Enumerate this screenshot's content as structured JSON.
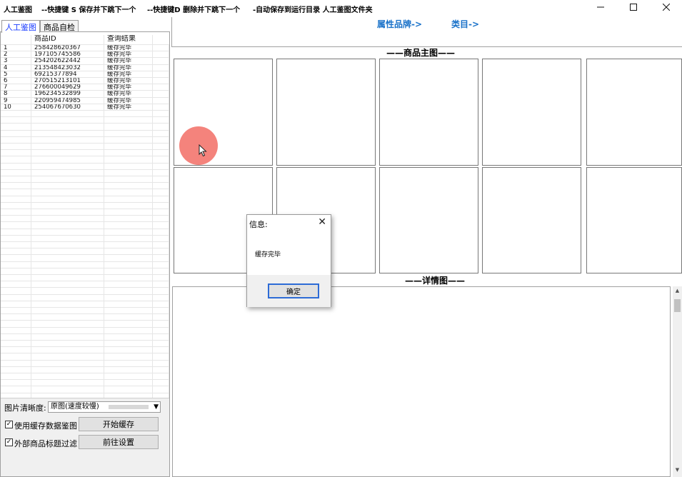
{
  "titlebar": {
    "segments": [
      "人工鉴图",
      "--快捷键 S 保存并下跳下一个",
      "--快捷键D 删除并下跳下一个",
      "-自动保存到运行目录 人工鉴图文件夹"
    ],
    "minimize_icon": "minimize-icon",
    "maximize_icon": "maximize-icon",
    "close_icon": "close-icon"
  },
  "tabs": [
    {
      "label": "人工鉴图",
      "active": true
    },
    {
      "label": "商品自检",
      "active": false
    }
  ],
  "grid": {
    "headers": [
      "商品ID",
      "查询结果"
    ],
    "rows": [
      {
        "n": "1",
        "id": "258428620367",
        "result": "缓存完毕"
      },
      {
        "n": "2",
        "id": "197105745586",
        "result": "缓存完毕"
      },
      {
        "n": "3",
        "id": "254202622442",
        "result": "缓存完毕"
      },
      {
        "n": "4",
        "id": "213548423032",
        "result": "缓存完毕"
      },
      {
        "n": "5",
        "id": "69215377894",
        "result": "缓存完毕"
      },
      {
        "n": "6",
        "id": "270515213101",
        "result": "缓存完毕"
      },
      {
        "n": "7",
        "id": "276600049629",
        "result": "缓存完毕"
      },
      {
        "n": "8",
        "id": "196234532899",
        "result": "缓存完毕"
      },
      {
        "n": "9",
        "id": "220959474985",
        "result": "缓存完毕"
      },
      {
        "n": "10",
        "id": "254067670630",
        "result": "缓存完毕"
      }
    ]
  },
  "controls": {
    "clarity_label": "图片清晰度:",
    "clarity_value": "原图(速度较慢)",
    "use_cache_label": "使用缓存数据鉴图",
    "use_cache_checked": "✓",
    "filter_label": "外部商品标题过滤",
    "filter_checked": "✓",
    "start_cache_button": "开始缓存",
    "settings_button": "前往设置"
  },
  "right": {
    "attr_brand_link": "属性品牌->",
    "category_link": "类目->",
    "main_images_title": "——商品主图——",
    "detail_title": "——详情图——"
  },
  "dialog": {
    "title": "信息:",
    "message": "缓存完毕",
    "ok_button": "确定",
    "close_glyph": "✕"
  },
  "colors": {
    "link": "#1a72c9",
    "tab_active": "#1a3cff",
    "cursor_halo": "#f05a50",
    "ok_border": "#2d6bd6"
  }
}
